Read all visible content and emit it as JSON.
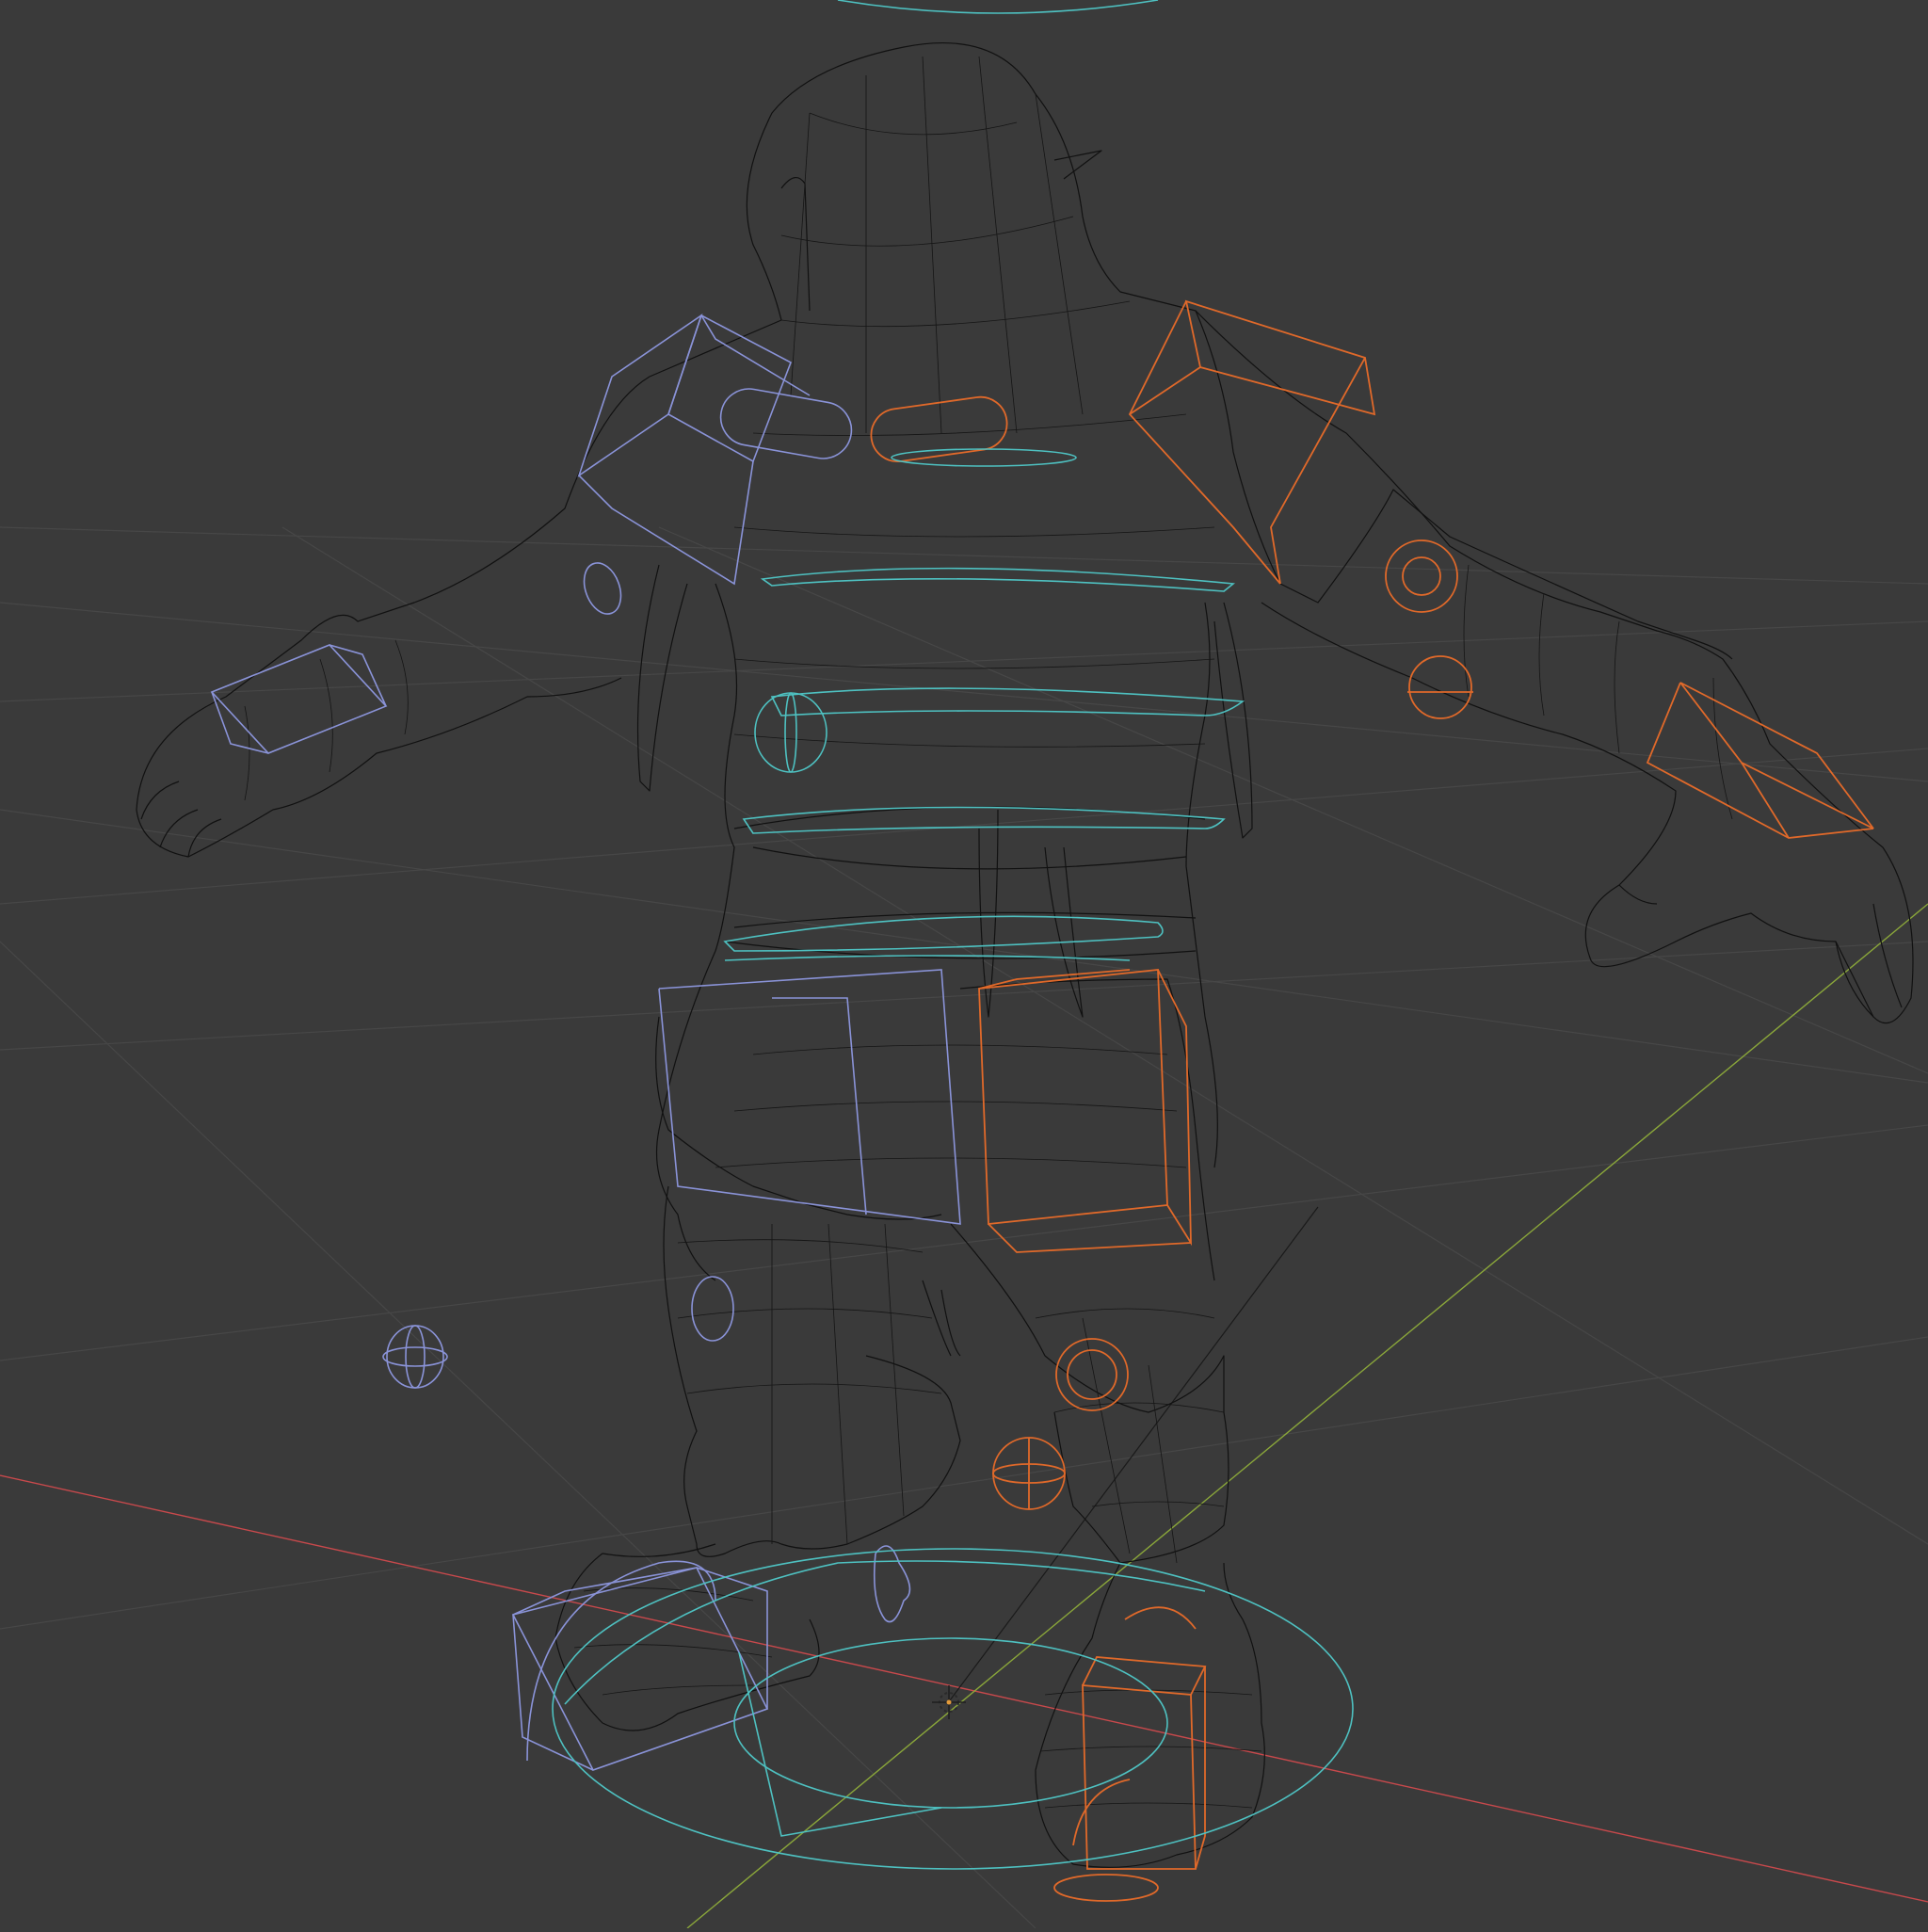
{
  "viewport": {
    "shading": "wireframe",
    "background": "#3a3a3a",
    "grid_color": "#474747",
    "mesh_color": "#111111"
  },
  "axes": {
    "x_axis_color": "#c8494c",
    "y_axis_color": "#8aa63a"
  },
  "rig": {
    "left_side_controls_color": "#8a93d8",
    "right_side_controls_color": "#e0692a",
    "center_controls_color": "#4ec1c1"
  },
  "icons": {
    "origin": "3d-cursor-icon",
    "empty": "sphere-empty-icon"
  }
}
